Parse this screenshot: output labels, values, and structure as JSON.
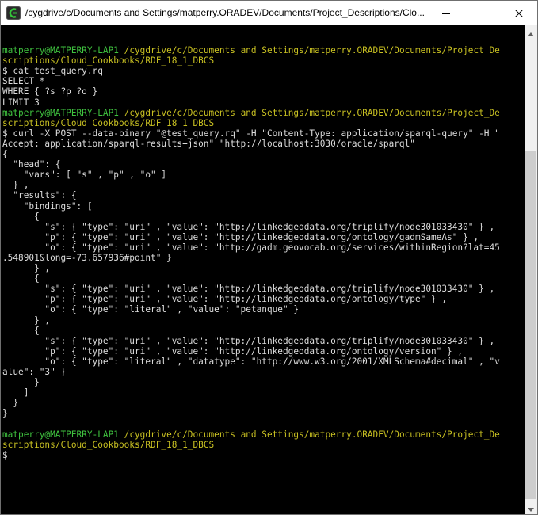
{
  "window": {
    "title": "/cygdrive/c/Documents and Settings/matperry.ORADEV/Documents/Project_Descriptions/Clo..."
  },
  "icons": {
    "app": "cygwin-terminal-icon",
    "minimize": "minimize-icon",
    "maximize": "maximize-icon",
    "close": "close-icon",
    "scroll_up": "scroll-up-arrow-icon",
    "scroll_down": "scroll-down-arrow-icon"
  },
  "colors": {
    "prompt_user": "#3fc23f",
    "prompt_path": "#c8c022",
    "text": "#dcdcdc",
    "background": "#000000"
  },
  "terminal": {
    "lines": [
      [],
      [
        {
          "text": "matperry@MATPERRY-LAP1",
          "color": "green"
        },
        {
          "text": " ",
          "color": "white"
        },
        {
          "text": "/cygdrive/c/Documents and Settings/matperry.ORADEV/Documents/Project_De",
          "color": "yellow"
        }
      ],
      [
        {
          "text": "scriptions/Cloud_Cookbooks/RDF_18_1_DBCS",
          "color": "yellow"
        }
      ],
      [
        {
          "text": "$ cat test_query.rq",
          "color": "white"
        }
      ],
      [
        {
          "text": "SELECT *",
          "color": "white"
        }
      ],
      [
        {
          "text": "WHERE { ?s ?p ?o }",
          "color": "white"
        }
      ],
      [
        {
          "text": "LIMIT 3",
          "color": "white"
        }
      ],
      [
        {
          "text": "matperry@MATPERRY-LAP1",
          "color": "green"
        },
        {
          "text": " ",
          "color": "white"
        },
        {
          "text": "/cygdrive/c/Documents and Settings/matperry.ORADEV/Documents/Project_De",
          "color": "yellow"
        }
      ],
      [
        {
          "text": "scriptions/Cloud_Cookbooks/RDF_18_1_DBCS",
          "color": "yellow"
        }
      ],
      [
        {
          "text": "$ curl -X POST --data-binary \"@test_query.rq\" -H \"Content-Type: application/sparql-query\" -H \"",
          "color": "white"
        }
      ],
      [
        {
          "text": "Accept: application/sparql-results+json\" \"http://localhost:3030/oracle/sparql\"",
          "color": "white"
        }
      ],
      [
        {
          "text": "{",
          "color": "white"
        }
      ],
      [
        {
          "text": "  \"head\": {",
          "color": "white"
        }
      ],
      [
        {
          "text": "    \"vars\": [ \"s\" , \"p\" , \"o\" ]",
          "color": "white"
        }
      ],
      [
        {
          "text": "  } ,",
          "color": "white"
        }
      ],
      [
        {
          "text": "  \"results\": {",
          "color": "white"
        }
      ],
      [
        {
          "text": "    \"bindings\": [",
          "color": "white"
        }
      ],
      [
        {
          "text": "      {",
          "color": "white"
        }
      ],
      [
        {
          "text": "        \"s\": { \"type\": \"uri\" , \"value\": \"http://linkedgeodata.org/triplify/node301033430\" } ,",
          "color": "white"
        }
      ],
      [
        {
          "text": "        \"p\": { \"type\": \"uri\" , \"value\": \"http://linkedgeodata.org/ontology/gadmSameAs\" } ,",
          "color": "white"
        }
      ],
      [
        {
          "text": "        \"o\": { \"type\": \"uri\" , \"value\": \"http://gadm.geovocab.org/services/withinRegion?lat=45",
          "color": "white"
        }
      ],
      [
        {
          "text": ".548901&long=-73.657936#point\" }",
          "color": "white"
        }
      ],
      [
        {
          "text": "      } ,",
          "color": "white"
        }
      ],
      [
        {
          "text": "      {",
          "color": "white"
        }
      ],
      [
        {
          "text": "        \"s\": { \"type\": \"uri\" , \"value\": \"http://linkedgeodata.org/triplify/node301033430\" } ,",
          "color": "white"
        }
      ],
      [
        {
          "text": "        \"p\": { \"type\": \"uri\" , \"value\": \"http://linkedgeodata.org/ontology/type\" } ,",
          "color": "white"
        }
      ],
      [
        {
          "text": "        \"o\": { \"type\": \"literal\" , \"value\": \"petanque\" }",
          "color": "white"
        }
      ],
      [
        {
          "text": "      } ,",
          "color": "white"
        }
      ],
      [
        {
          "text": "      {",
          "color": "white"
        }
      ],
      [
        {
          "text": "        \"s\": { \"type\": \"uri\" , \"value\": \"http://linkedgeodata.org/triplify/node301033430\" } ,",
          "color": "white"
        }
      ],
      [
        {
          "text": "        \"p\": { \"type\": \"uri\" , \"value\": \"http://linkedgeodata.org/ontology/version\" } ,",
          "color": "white"
        }
      ],
      [
        {
          "text": "        \"o\": { \"type\": \"literal\" , \"datatype\": \"http://www.w3.org/2001/XMLSchema#decimal\" , \"v",
          "color": "white"
        }
      ],
      [
        {
          "text": "alue\": \"3\" }",
          "color": "white"
        }
      ],
      [
        {
          "text": "      }",
          "color": "white"
        }
      ],
      [
        {
          "text": "    ]",
          "color": "white"
        }
      ],
      [
        {
          "text": "  }",
          "color": "white"
        }
      ],
      [
        {
          "text": "}",
          "color": "white"
        }
      ],
      [],
      [
        {
          "text": "matperry@MATPERRY-LAP1",
          "color": "green"
        },
        {
          "text": " ",
          "color": "white"
        },
        {
          "text": "/cygdrive/c/Documents and Settings/matperry.ORADEV/Documents/Project_De",
          "color": "yellow"
        }
      ],
      [
        {
          "text": "scriptions/Cloud_Cookbooks/RDF_18_1_DBCS",
          "color": "yellow"
        }
      ],
      [
        {
          "text": "$",
          "color": "white"
        }
      ]
    ]
  }
}
